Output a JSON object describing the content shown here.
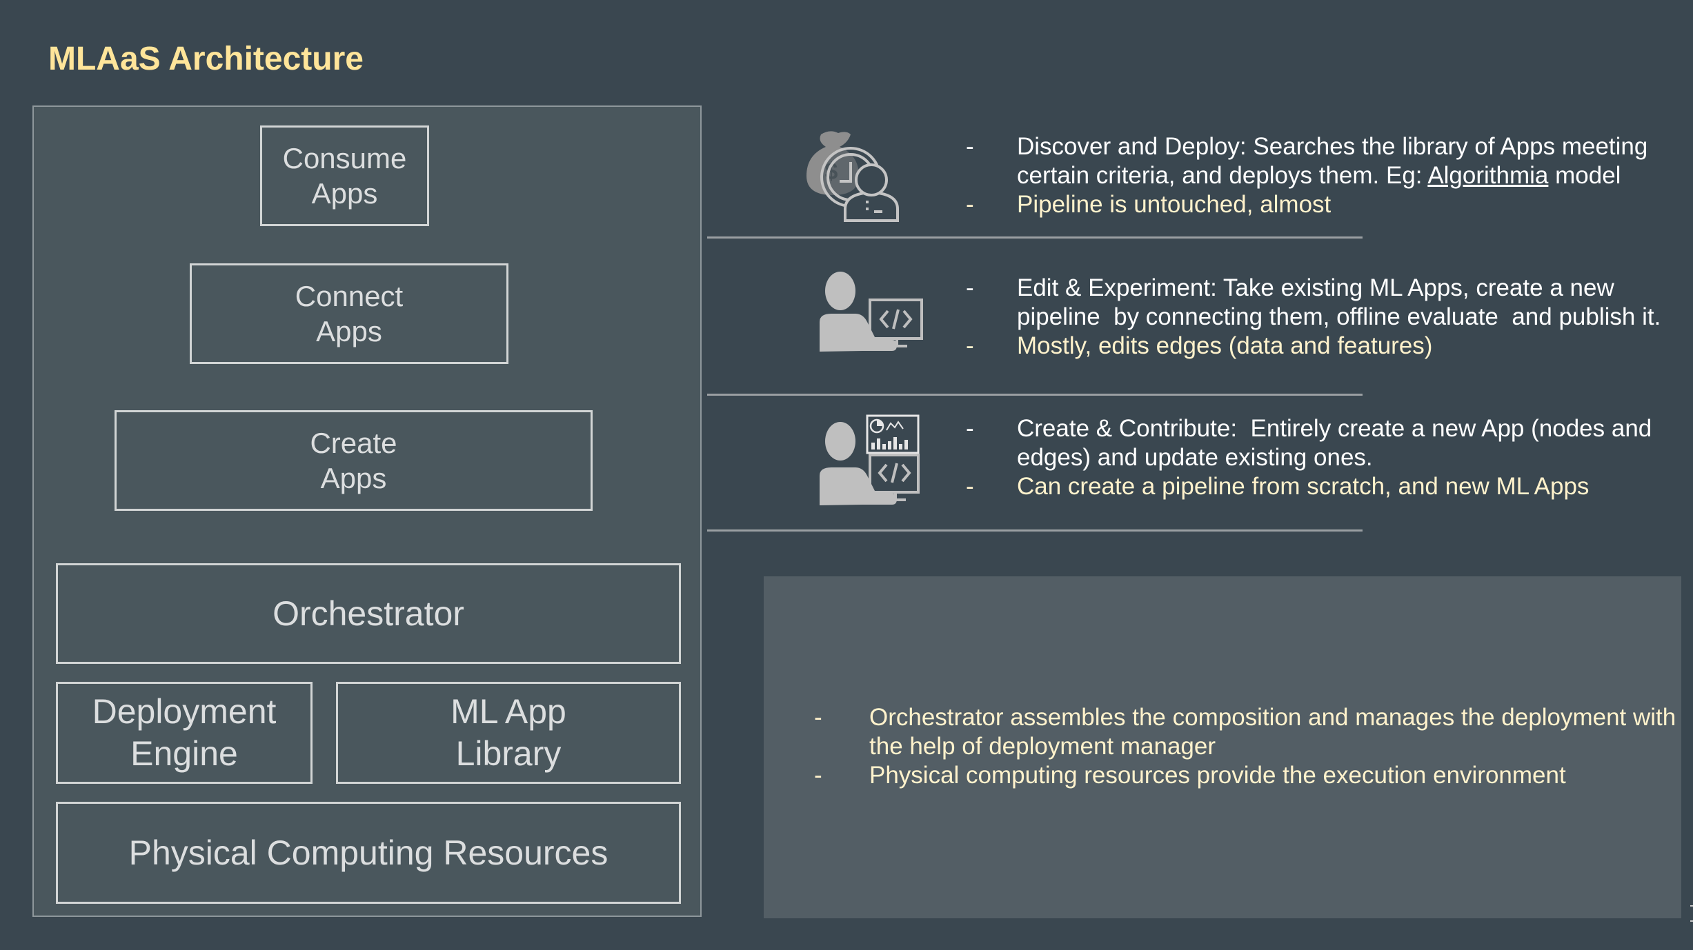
{
  "title": "MLAaS Architecture",
  "architecture": {
    "consume_apps": "Consume\nApps",
    "connect_apps": "Connect\nApps",
    "create_apps": "Create\nApps",
    "orchestrator": "Orchestrator",
    "deployment_engine": "Deployment\nEngine",
    "ml_app_library": "ML App\nLibrary",
    "physical_computing": "Physical Computing Resources"
  },
  "rows": [
    {
      "icon": "money-clock-person-icon",
      "bullets": [
        {
          "dash": "-",
          "text_before": "Discover and Deploy: Searches the library of Apps meeting certain criteria, and deploys them. Eg: ",
          "link": "Algorithmia",
          "text_after": " model"
        },
        {
          "dash": "-",
          "text": "Pipeline is untouched, almost"
        }
      ]
    },
    {
      "icon": "developer-code-icon",
      "bullets": [
        {
          "dash": "-",
          "text": "Edit & Experiment: Take existing ML Apps, create a new pipeline  by connecting them, offline evaluate  and publish it."
        },
        {
          "dash": "-",
          "text": "Mostly, edits edges (data and features)"
        }
      ]
    },
    {
      "icon": "developer-dashboard-icon",
      "bullets": [
        {
          "dash": "-",
          "text": "Create & Contribute:  Entirely create a new App (nodes and edges) and update existing ones."
        },
        {
          "dash": "-",
          "text": "Can create a pipeline from scratch, and new ML Apps"
        }
      ]
    }
  ],
  "panel": {
    "bullets": [
      {
        "dash": "-",
        "text": "Orchestrator assembles the composition and manages the deployment with the help of deployment manager"
      },
      {
        "dash": "-",
        "text": "Physical computing resources provide the execution environment"
      }
    ]
  },
  "colors": {
    "background": "#3a4750",
    "title": "#ffe59a",
    "container": "#4a575d",
    "panel": "#535e65",
    "primary_text": "#ffffff",
    "highlight_text": "#fff2cc",
    "icon": "#bfbfbf"
  }
}
